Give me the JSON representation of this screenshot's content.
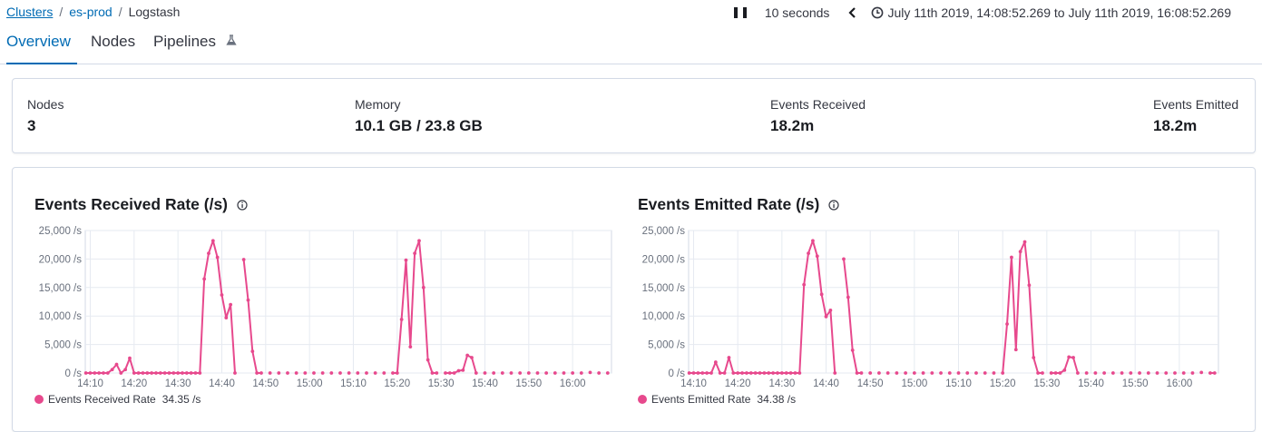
{
  "breadcrumb": {
    "clusters": "Clusters",
    "cluster": "es-prod",
    "current": "Logstash",
    "separator": "/"
  },
  "time": {
    "refresh_interval": "10 seconds",
    "range": "July 11th 2019, 14:08:52.269 to July 11th 2019, 16:08:52.269"
  },
  "tabs": {
    "overview": "Overview",
    "nodes": "Nodes",
    "pipelines": "Pipelines"
  },
  "stats": {
    "nodes": {
      "label": "Nodes",
      "value": "3"
    },
    "memory": {
      "label": "Memory",
      "value": "10.1 GB / 23.8 GB"
    },
    "received": {
      "label": "Events Received",
      "value": "18.2m"
    },
    "emitted": {
      "label": "Events Emitted",
      "value": "18.2m"
    }
  },
  "colors": {
    "accent": "#006bb4",
    "series": "#e7498d"
  },
  "chart_data": [
    {
      "type": "line",
      "title": "Events Received Rate (/s)",
      "ylim": [
        0,
        25000
      ],
      "yticks": [
        0,
        5000,
        10000,
        15000,
        20000,
        25000
      ],
      "ytick_labels": [
        "0 /s",
        "5,000 /s",
        "10,000 /s",
        "15,000 /s",
        "20,000 /s",
        "25,000 /s"
      ],
      "xlim": [
        "14:08:52",
        "16:08:52"
      ],
      "xticks": [
        "14:10",
        "14:20",
        "14:30",
        "14:40",
        "14:50",
        "15:00",
        "15:10",
        "15:20",
        "15:30",
        "15:40",
        "15:50",
        "16:00"
      ],
      "grid": true,
      "legend": "bottom-left",
      "series": [
        {
          "name": "Events Received Rate",
          "last_value_label": "34.35 /s",
          "points": [
            {
              "x": "14:09:00",
              "y": 0
            },
            {
              "x": "14:10:00",
              "y": 0
            },
            {
              "x": "14:11:00",
              "y": 0
            },
            {
              "x": "14:12:00",
              "y": 0
            },
            {
              "x": "14:13:00",
              "y": 0
            },
            {
              "x": "14:14:00",
              "y": 0
            },
            {
              "x": "14:15:00",
              "y": 600
            },
            {
              "x": "14:16:00",
              "y": 1500
            },
            {
              "x": "14:17:00",
              "y": 0
            },
            {
              "x": "14:18:00",
              "y": 600
            },
            {
              "x": "14:19:00",
              "y": 2600
            },
            {
              "x": "14:20:00",
              "y": 0
            },
            {
              "x": "14:21:00",
              "y": 0
            },
            {
              "x": "14:22:00",
              "y": 0
            },
            {
              "x": "14:23:00",
              "y": 0
            },
            {
              "x": "14:24:00",
              "y": 0
            },
            {
              "x": "14:25:00",
              "y": 0
            },
            {
              "x": "14:26:00",
              "y": 0
            },
            {
              "x": "14:27:00",
              "y": 0
            },
            {
              "x": "14:28:00",
              "y": 0
            },
            {
              "x": "14:29:00",
              "y": 0
            },
            {
              "x": "14:30:00",
              "y": 0
            },
            {
              "x": "14:31:00",
              "y": 0
            },
            {
              "x": "14:32:00",
              "y": 0
            },
            {
              "x": "14:33:00",
              "y": 0
            },
            {
              "x": "14:34:00",
              "y": 0
            },
            {
              "x": "14:35:00",
              "y": 0
            },
            {
              "x": "14:36:00",
              "y": 16500
            },
            {
              "x": "14:37:00",
              "y": 21000
            },
            {
              "x": "14:38:00",
              "y": 23200
            },
            {
              "x": "14:39:00",
              "y": 20300
            },
            {
              "x": "14:40:00",
              "y": 13700
            },
            {
              "x": "14:41:00",
              "y": 9700
            },
            {
              "x": "14:42:00",
              "y": 12000
            },
            {
              "x": "14:43:00",
              "y": 0
            },
            {
              "x": "14:45:00",
              "y": 19900
            },
            {
              "x": "14:46:00",
              "y": 12800
            },
            {
              "x": "14:47:00",
              "y": 3800
            },
            {
              "x": "14:48:00",
              "y": 0
            },
            {
              "x": "14:49:00",
              "y": 0
            },
            {
              "x": "14:51:00",
              "y": 0
            },
            {
              "x": "14:53:00",
              "y": 0
            },
            {
              "x": "14:55:00",
              "y": 0
            },
            {
              "x": "14:57:00",
              "y": 0
            },
            {
              "x": "14:59:00",
              "y": 0
            },
            {
              "x": "15:01:00",
              "y": 0
            },
            {
              "x": "15:03:00",
              "y": 0
            },
            {
              "x": "15:05:00",
              "y": 0
            },
            {
              "x": "15:07:00",
              "y": 0
            },
            {
              "x": "15:09:00",
              "y": 0
            },
            {
              "x": "15:11:00",
              "y": 0
            },
            {
              "x": "15:13:00",
              "y": 0
            },
            {
              "x": "15:15:00",
              "y": 0
            },
            {
              "x": "15:17:00",
              "y": 0
            },
            {
              "x": "15:19:00",
              "y": 0
            },
            {
              "x": "15:20:00",
              "y": 0
            },
            {
              "x": "15:21:00",
              "y": 9400
            },
            {
              "x": "15:22:00",
              "y": 19800
            },
            {
              "x": "15:23:00",
              "y": 4600
            },
            {
              "x": "15:24:00",
              "y": 21000
            },
            {
              "x": "15:25:00",
              "y": 23200
            },
            {
              "x": "15:26:00",
              "y": 15000
            },
            {
              "x": "15:27:00",
              "y": 2300
            },
            {
              "x": "15:28:00",
              "y": 0
            },
            {
              "x": "15:29:00",
              "y": 0
            },
            {
              "x": "15:31:00",
              "y": 0
            },
            {
              "x": "15:32:00",
              "y": 0
            },
            {
              "x": "15:33:00",
              "y": 0
            },
            {
              "x": "15:34:00",
              "y": 400
            },
            {
              "x": "15:35:00",
              "y": 500
            },
            {
              "x": "15:36:00",
              "y": 3100
            },
            {
              "x": "15:37:00",
              "y": 2700
            },
            {
              "x": "15:38:00",
              "y": 0
            },
            {
              "x": "15:40:00",
              "y": 0
            },
            {
              "x": "15:42:00",
              "y": 0
            },
            {
              "x": "15:44:00",
              "y": 0
            },
            {
              "x": "15:46:00",
              "y": 0
            },
            {
              "x": "15:48:00",
              "y": 0
            },
            {
              "x": "15:50:00",
              "y": 0
            },
            {
              "x": "15:52:00",
              "y": 0
            },
            {
              "x": "15:54:00",
              "y": 0
            },
            {
              "x": "15:56:00",
              "y": 0
            },
            {
              "x": "15:58:00",
              "y": 0
            },
            {
              "x": "16:00:00",
              "y": 0
            },
            {
              "x": "16:02:00",
              "y": 0
            },
            {
              "x": "16:04:00",
              "y": 100
            },
            {
              "x": "16:06:00",
              "y": 0
            },
            {
              "x": "16:08:00",
              "y": 0
            }
          ]
        }
      ]
    },
    {
      "type": "line",
      "title": "Events Emitted Rate (/s)",
      "ylim": [
        0,
        25000
      ],
      "yticks": [
        0,
        5000,
        10000,
        15000,
        20000,
        25000
      ],
      "ytick_labels": [
        "0 /s",
        "5,000 /s",
        "10,000 /s",
        "15,000 /s",
        "20,000 /s",
        "25,000 /s"
      ],
      "xlim": [
        "14:08:52",
        "16:08:52"
      ],
      "xticks": [
        "14:10",
        "14:20",
        "14:30",
        "14:40",
        "14:50",
        "15:00",
        "15:10",
        "15:20",
        "15:30",
        "15:40",
        "15:50",
        "16:00"
      ],
      "grid": true,
      "legend": "bottom-left",
      "series": [
        {
          "name": "Events Emitted Rate",
          "last_value_label": "34.38 /s",
          "points": [
            {
              "x": "14:09:00",
              "y": 0
            },
            {
              "x": "14:10:00",
              "y": 0
            },
            {
              "x": "14:11:00",
              "y": 0
            },
            {
              "x": "14:12:00",
              "y": 0
            },
            {
              "x": "14:13:00",
              "y": 0
            },
            {
              "x": "14:14:00",
              "y": 0
            },
            {
              "x": "14:15:00",
              "y": 1900
            },
            {
              "x": "14:16:00",
              "y": 0
            },
            {
              "x": "14:17:00",
              "y": 0
            },
            {
              "x": "14:18:00",
              "y": 2700
            },
            {
              "x": "14:19:00",
              "y": 0
            },
            {
              "x": "14:20:00",
              "y": 0
            },
            {
              "x": "14:21:00",
              "y": 0
            },
            {
              "x": "14:22:00",
              "y": 0
            },
            {
              "x": "14:23:00",
              "y": 0
            },
            {
              "x": "14:24:00",
              "y": 0
            },
            {
              "x": "14:25:00",
              "y": 0
            },
            {
              "x": "14:26:00",
              "y": 0
            },
            {
              "x": "14:27:00",
              "y": 0
            },
            {
              "x": "14:28:00",
              "y": 0
            },
            {
              "x": "14:29:00",
              "y": 0
            },
            {
              "x": "14:30:00",
              "y": 0
            },
            {
              "x": "14:31:00",
              "y": 0
            },
            {
              "x": "14:32:00",
              "y": 0
            },
            {
              "x": "14:33:00",
              "y": 0
            },
            {
              "x": "14:34:00",
              "y": 0
            },
            {
              "x": "14:35:00",
              "y": 15500
            },
            {
              "x": "14:36:00",
              "y": 21000
            },
            {
              "x": "14:37:00",
              "y": 23200
            },
            {
              "x": "14:38:00",
              "y": 20500
            },
            {
              "x": "14:39:00",
              "y": 13800
            },
            {
              "x": "14:40:00",
              "y": 9900
            },
            {
              "x": "14:41:00",
              "y": 11000
            },
            {
              "x": "14:42:00",
              "y": 0
            },
            {
              "x": "14:44:00",
              "y": 20000
            },
            {
              "x": "14:45:00",
              "y": 13300
            },
            {
              "x": "14:46:00",
              "y": 4000
            },
            {
              "x": "14:47:00",
              "y": 0
            },
            {
              "x": "14:48:00",
              "y": 0
            },
            {
              "x": "14:50:00",
              "y": 0
            },
            {
              "x": "14:52:00",
              "y": 0
            },
            {
              "x": "14:54:00",
              "y": 0
            },
            {
              "x": "14:56:00",
              "y": 0
            },
            {
              "x": "14:58:00",
              "y": 0
            },
            {
              "x": "15:00:00",
              "y": 0
            },
            {
              "x": "15:02:00",
              "y": 0
            },
            {
              "x": "15:04:00",
              "y": 0
            },
            {
              "x": "15:06:00",
              "y": 0
            },
            {
              "x": "15:08:00",
              "y": 0
            },
            {
              "x": "15:10:00",
              "y": 0
            },
            {
              "x": "15:12:00",
              "y": 0
            },
            {
              "x": "15:14:00",
              "y": 0
            },
            {
              "x": "15:16:00",
              "y": 0
            },
            {
              "x": "15:18:00",
              "y": 0
            },
            {
              "x": "15:20:00",
              "y": 0
            },
            {
              "x": "15:21:00",
              "y": 8600
            },
            {
              "x": "15:22:00",
              "y": 20300
            },
            {
              "x": "15:23:00",
              "y": 4100
            },
            {
              "x": "15:24:00",
              "y": 21300
            },
            {
              "x": "15:25:00",
              "y": 23000
            },
            {
              "x": "15:26:00",
              "y": 15400
            },
            {
              "x": "15:27:00",
              "y": 2700
            },
            {
              "x": "15:28:00",
              "y": 0
            },
            {
              "x": "15:29:00",
              "y": 0
            },
            {
              "x": "15:31:00",
              "y": 0
            },
            {
              "x": "15:32:00",
              "y": 0
            },
            {
              "x": "15:33:00",
              "y": 0
            },
            {
              "x": "15:34:00",
              "y": 500
            },
            {
              "x": "15:35:00",
              "y": 2800
            },
            {
              "x": "15:36:00",
              "y": 2700
            },
            {
              "x": "15:37:00",
              "y": 0
            },
            {
              "x": "15:39:00",
              "y": 0
            },
            {
              "x": "15:41:00",
              "y": 0
            },
            {
              "x": "15:43:00",
              "y": 0
            },
            {
              "x": "15:45:00",
              "y": 0
            },
            {
              "x": "15:47:00",
              "y": 0
            },
            {
              "x": "15:49:00",
              "y": 0
            },
            {
              "x": "15:51:00",
              "y": 0
            },
            {
              "x": "15:53:00",
              "y": 0
            },
            {
              "x": "15:55:00",
              "y": 0
            },
            {
              "x": "15:57:00",
              "y": 0
            },
            {
              "x": "15:59:00",
              "y": 0
            },
            {
              "x": "16:01:00",
              "y": 0
            },
            {
              "x": "16:03:00",
              "y": 0
            },
            {
              "x": "16:05:00",
              "y": 100
            },
            {
              "x": "16:07:00",
              "y": 0
            },
            {
              "x": "16:08:00",
              "y": 0
            }
          ]
        }
      ]
    }
  ]
}
